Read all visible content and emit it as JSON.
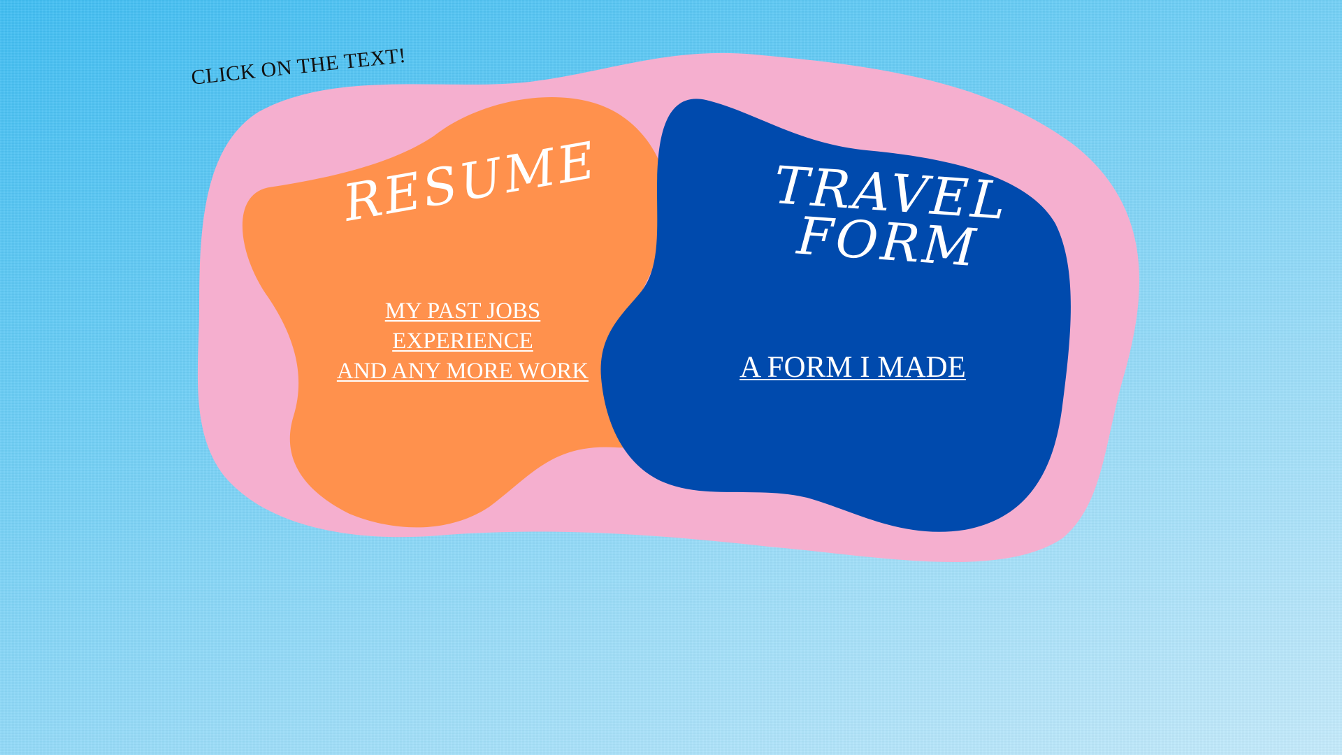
{
  "instruction": "CLICK ON THE TEXT!",
  "resume": {
    "title": "RESUME",
    "links": [
      "MY PAST JOBS",
      "EXPERIENCE",
      "AND ANY MORE WORK"
    ],
    "color": "#ff914d"
  },
  "travel": {
    "title_line1": "TRAVEL",
    "title_line2": "FORM",
    "link": "A FORM I MADE",
    "color": "#004aad"
  },
  "colors": {
    "background_top": "#3fbdf2",
    "background_bottom": "#c4eafb",
    "outer_blob": "#f5afcf"
  }
}
